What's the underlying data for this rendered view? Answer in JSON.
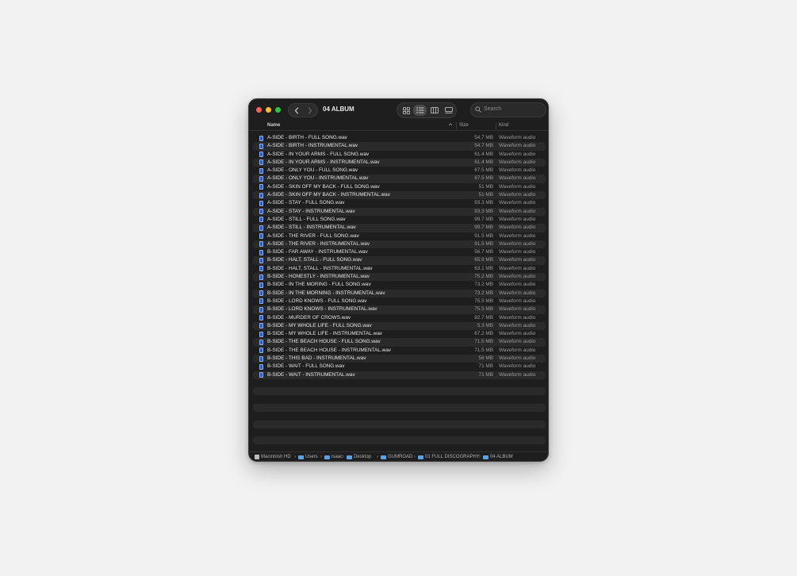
{
  "window": {
    "title": "04 ALBUM",
    "search_placeholder": "Search"
  },
  "toolbar_icons": {
    "back": "chevron-left-icon",
    "forward": "chevron-right-icon",
    "views": [
      "grid-view-icon",
      "list-view-icon",
      "column-view-icon",
      "gallery-view-icon"
    ],
    "active_view": "list-view-icon"
  },
  "columns": {
    "name": "Name",
    "size": "Size",
    "kind": "Kind",
    "sort_indicator": "^"
  },
  "files": [
    {
      "name": "A-SIDE - BIRTH - FULL SONG.wav",
      "size": "54.7 MB",
      "kind": "Waveform audio"
    },
    {
      "name": "A-SIDE - BIRTH - INSTRUMENTAL.wav",
      "size": "54.7 MB",
      "kind": "Waveform audio"
    },
    {
      "name": "A-SIDE - IN YOUR ARMS - FULL SONG.wav",
      "size": "61.4 MB",
      "kind": "Waveform audio"
    },
    {
      "name": "A-SIDE - IN YOUR ARMS - INSTRUMENTAL.wav",
      "size": "61.4 MB",
      "kind": "Waveform audio"
    },
    {
      "name": "A-SIDE - ONLY YOU - FULL SONG.wav",
      "size": "67.5 MB",
      "kind": "Waveform audio"
    },
    {
      "name": "A-SIDE - ONLY YOU - INSTRUMENTAL.wav",
      "size": "67.5 MB",
      "kind": "Waveform audio"
    },
    {
      "name": "A-SIDE - SKIN OFF MY BACK - FULL SONG.wav",
      "size": "51 MB",
      "kind": "Waveform audio"
    },
    {
      "name": "A-SIDE - SKIN OFF MY BACK - INSTRUMENTAL.wav",
      "size": "51 MB",
      "kind": "Waveform audio"
    },
    {
      "name": "A-SIDE - STAY - FULL SONG.wav",
      "size": "93.3 MB",
      "kind": "Waveform audio"
    },
    {
      "name": "A-SIDE - STAY - INSTRUMENTAL.wav",
      "size": "93.3 MB",
      "kind": "Waveform audio"
    },
    {
      "name": "A-SIDE - STILL - FULL SONG.wav",
      "size": "99.7 MB",
      "kind": "Waveform audio"
    },
    {
      "name": "A-SIDE - STILL - INSTRUMENTAL.wav",
      "size": "99.7 MB",
      "kind": "Waveform audio"
    },
    {
      "name": "A-SIDE - THE RIVER - FULL SONG.wav",
      "size": "91.5 MB",
      "kind": "Waveform audio"
    },
    {
      "name": "A-SIDE - THE RIVER - INSTRUMENTAL.wav",
      "size": "91.5 MB",
      "kind": "Waveform audio"
    },
    {
      "name": "B-SIDE - FAR AWAY - INSTRUMENTAL.wav",
      "size": "56.7 MB",
      "kind": "Waveform audio"
    },
    {
      "name": "B-SIDE - HALT, STALL - FULL SONG.wav",
      "size": "65.9 MB",
      "kind": "Waveform audio"
    },
    {
      "name": "B-SIDE - HALT, STALL - INSTRUMENTAL.wav",
      "size": "63.1 MB",
      "kind": "Waveform audio"
    },
    {
      "name": "B-SIDE - HONESTLY - INSTRUMENTAL.wav",
      "size": "75.2 MB",
      "kind": "Waveform audio"
    },
    {
      "name": "B-SIDE - IN THE MORING - FULL SONG.wav",
      "size": "73.2 MB",
      "kind": "Waveform audio"
    },
    {
      "name": "B-SIDE - IN THE MORNING - INSTRUMENTAL.wav",
      "size": "73.2 MB",
      "kind": "Waveform audio"
    },
    {
      "name": "B-SIDE - LORD KNOWS - FULL SONG.wav",
      "size": "75.5 MB",
      "kind": "Waveform audio"
    },
    {
      "name": "B-SIDE - LORD KNOWS - INSTRUMENTAL.wav",
      "size": "75.5 MB",
      "kind": "Waveform audio"
    },
    {
      "name": "B-SIDE - MURDER OF CROWS.wav",
      "size": "82.7 MB",
      "kind": "Waveform audio"
    },
    {
      "name": "B-SIDE - MY WHOLE LIFE - FULL SONG.wav",
      "size": "5.3 MB",
      "kind": "Waveform audio"
    },
    {
      "name": "B-SIDE - MY WHOLE LIFE - INSTRUMENTAL.wav",
      "size": "67.2 MB",
      "kind": "Waveform audio"
    },
    {
      "name": "B-SIDE - THE BEACH HOUSE - FULL SONG.wav",
      "size": "71.5 MB",
      "kind": "Waveform audio"
    },
    {
      "name": "B-SIDE - THE BEACH HOUSE - INSTRUMENTAL.wav",
      "size": "71.5 MB",
      "kind": "Waveform audio"
    },
    {
      "name": "B-SIDE - THIS BAD - INSTRUMENTAL.wav",
      "size": "56 MB",
      "kind": "Waveform audio"
    },
    {
      "name": "B-SIDE - WAIT - FULL SONG.wav",
      "size": "71 MB",
      "kind": "Waveform audio"
    },
    {
      "name": "B-SIDE - WAIT - INSTRUMENTAL.wav",
      "size": "71 MB",
      "kind": "Waveform audio"
    }
  ],
  "path_bar": [
    "Macintosh HD",
    "Users",
    "isaac",
    "Desktop",
    "GUMROAD",
    "01 FULL DISCOGRAPHY",
    "04 ALBUM"
  ],
  "colors": {
    "window_bg": "#1e1e1e",
    "row_alt": "#2a2a2a",
    "file_icon": "#1f5ed8",
    "folder_icon": "#5aa2e6",
    "close": "#fe5f57",
    "minimize": "#febc2e",
    "zoom": "#28c840"
  }
}
